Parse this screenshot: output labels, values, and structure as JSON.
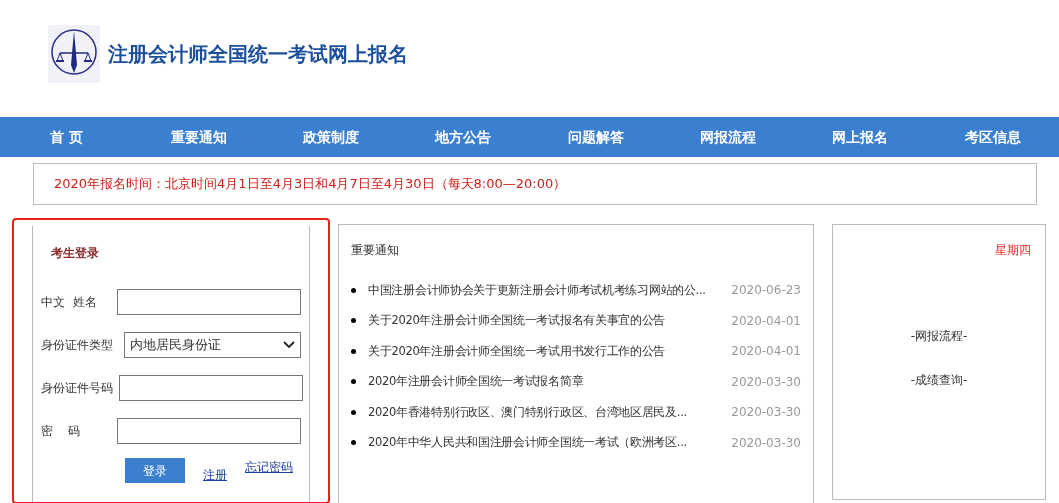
{
  "header": {
    "title": "注册会计师全国统一考试网上报名"
  },
  "nav": [
    {
      "label": "首 页"
    },
    {
      "label": "重要通知"
    },
    {
      "label": "政策制度"
    },
    {
      "label": "地方公告"
    },
    {
      "label": "问题解答"
    },
    {
      "label": "网报流程"
    },
    {
      "label": "网上报名"
    },
    {
      "label": "考区信息"
    }
  ],
  "notice": "2020年报名时间：北京时间4月1日至4月3日和4月7日至4月30日（每天8:00—20:00）",
  "login": {
    "title": "考生登录",
    "fields": [
      {
        "kind": "text",
        "label": "中文  姓名"
      },
      {
        "kind": "select",
        "label": "身份证件类型",
        "value": "内地居民身份证"
      },
      {
        "kind": "text",
        "label": "身份证件号码"
      },
      {
        "kind": "password",
        "label": "密    码"
      }
    ],
    "submit": "登录",
    "links": [
      "注册",
      "忘记密码"
    ]
  },
  "news": {
    "title": "重要通知",
    "items": [
      {
        "title": "中国注册会计师协会关于更新注册会计师考试机考练习网站的公...",
        "date": "2020-06-23"
      },
      {
        "title": "关于2020年注册会计师全国统一考试报名有关事宜的公告",
        "date": "2020-04-01"
      },
      {
        "title": "关于2020年注册会计师全国统一考试用书发行工作的公告",
        "date": "2020-04-01"
      },
      {
        "title": "2020年注册会计师全国统一考试报名简章",
        "date": "2020-03-30"
      },
      {
        "title": "2020年香港特别行政区、澳门特别行政区、台湾地区居民及...",
        "date": "2020-03-30"
      },
      {
        "title": "2020年中华人民共和国注册会计师全国统一考试（欧洲考区...",
        "date": "2020-03-30"
      }
    ]
  },
  "side": {
    "weekday": "星期四",
    "links": [
      "-网报流程-",
      "-成绩查询-"
    ]
  }
}
